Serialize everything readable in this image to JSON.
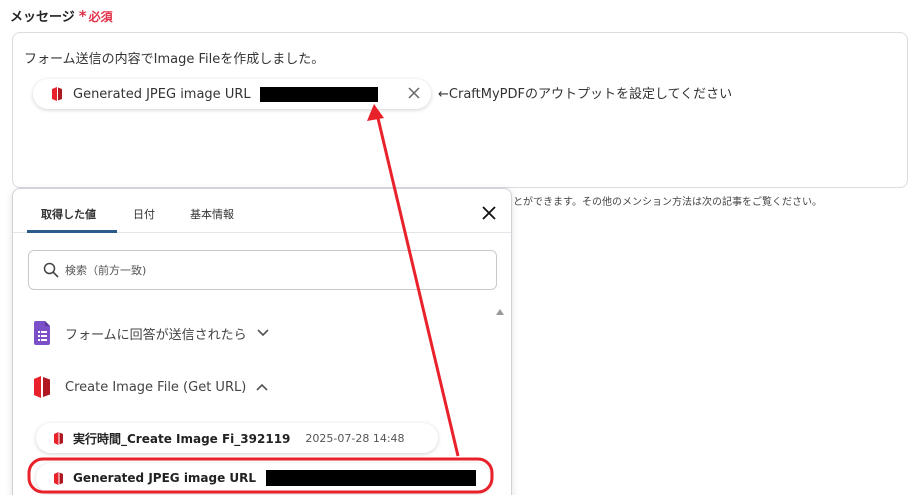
{
  "field": {
    "label": "メッセージ",
    "required_mark": "*",
    "required_text": "必須"
  },
  "message": {
    "text": "フォーム送信の内容でImage Fileを作成しました。",
    "chip_label": "Generated JPEG image URL",
    "hint": "←CraftMyPDFのアウトプットを設定してください"
  },
  "help_text": "とができます。その他のメンション方法は次の記事をご覧ください。",
  "picker": {
    "tabs": [
      {
        "label": "取得した値",
        "active": true
      },
      {
        "label": "日付",
        "active": false
      },
      {
        "label": "基本情報",
        "active": false
      }
    ],
    "search_placeholder": "検索（前方一致)",
    "groups": [
      {
        "label": "フォームに回答が送信されたら",
        "expanded": false,
        "icon": "form-icon"
      },
      {
        "label": "Create Image File (Get URL)",
        "expanded": true,
        "icon": "craftmypdf-icon"
      }
    ],
    "results": [
      {
        "label": "実行時間_Create Image Fi_392119",
        "time": "2025-07-28 14:48"
      },
      {
        "label": "Generated JPEG image URL",
        "time": ""
      }
    ]
  },
  "colors": {
    "accent": "#2a5b8c",
    "required": "#e0334a",
    "annotation": "#e8212b",
    "form_icon": "#7b4fc7"
  }
}
